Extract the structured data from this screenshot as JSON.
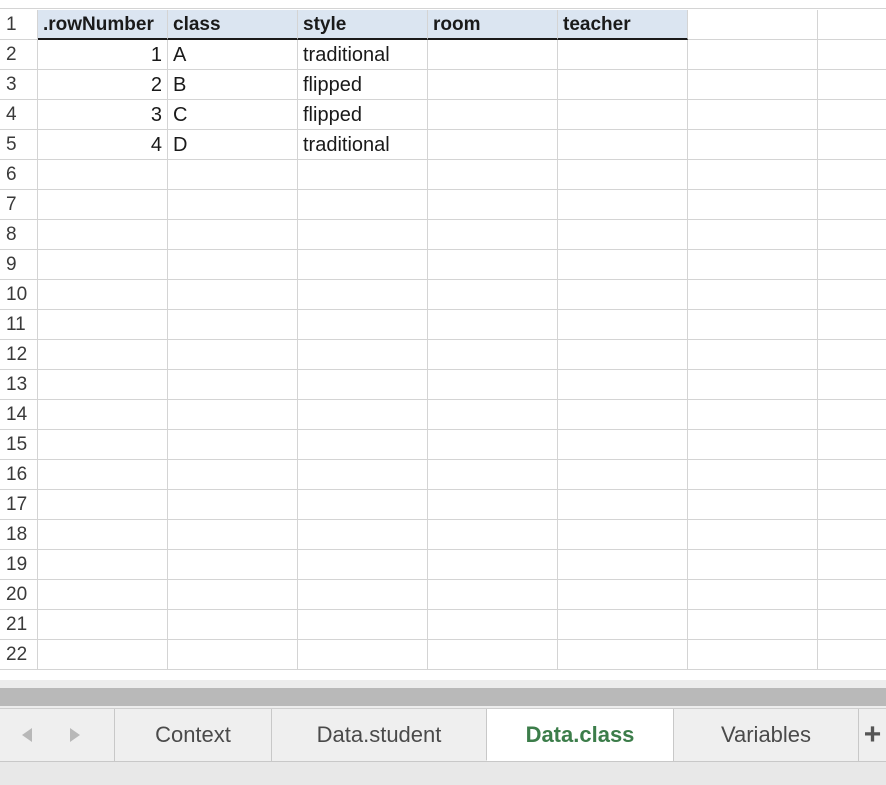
{
  "sheet": {
    "columns": [
      ".rowNumber",
      "class",
      "style",
      "room",
      "teacher"
    ],
    "row_numbers": [
      "1",
      "2",
      "3",
      "4",
      "5",
      "6",
      "7",
      "8",
      "9",
      "10",
      "11",
      "12",
      "13",
      "14",
      "15",
      "16",
      "17",
      "18",
      "19",
      "20",
      "21",
      "22"
    ],
    "rows": [
      {
        "rowNumber": "1",
        "class": "A",
        "style": "traditional",
        "room": "",
        "teacher": ""
      },
      {
        "rowNumber": "2",
        "class": "B",
        "style": "flipped",
        "room": "",
        "teacher": ""
      },
      {
        "rowNumber": "3",
        "class": "C",
        "style": "flipped",
        "room": "",
        "teacher": ""
      },
      {
        "rowNumber": "4",
        "class": "D",
        "style": "traditional",
        "room": "",
        "teacher": ""
      }
    ]
  },
  "tabs": {
    "items": [
      {
        "label": "Context",
        "active": false
      },
      {
        "label": "Data.student",
        "active": false
      },
      {
        "label": "Data.class",
        "active": true
      },
      {
        "label": "Variables",
        "active": false
      }
    ],
    "add_label": "+"
  },
  "colors": {
    "header_fill": "#dbe5f1",
    "active_tab_text": "#3c7d4a",
    "gridline": "#d4d4d4"
  },
  "icons": {
    "prev": "chevron-left-icon",
    "next": "chevron-right-icon",
    "add": "plus-icon"
  }
}
